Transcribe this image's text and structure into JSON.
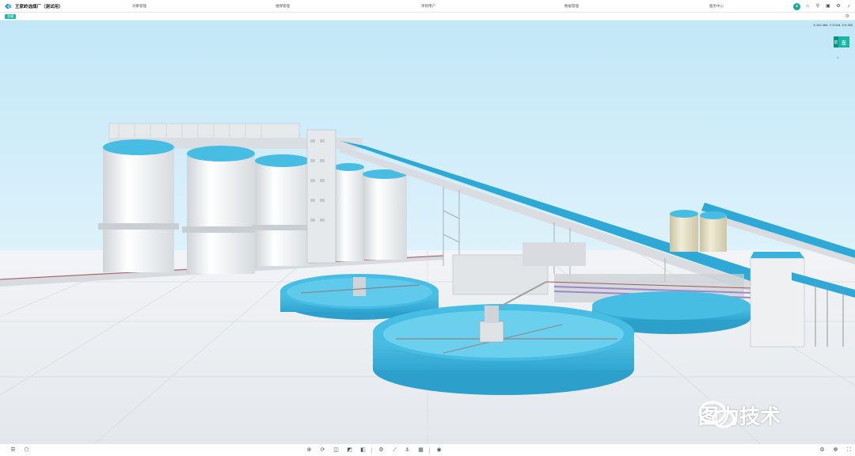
{
  "app": {
    "title": "王家岭选煤厂（测试用）"
  },
  "nav": [
    {
      "label": "对象管理"
    },
    {
      "label": "维保管理"
    },
    {
      "label": "项目用户"
    },
    {
      "label": "数据管理"
    },
    {
      "label": "服务中心"
    }
  ],
  "top_icons": [
    "user-avatar-icon",
    "home-icon",
    "search-icon",
    "layers-icon",
    "gear-icon",
    "bell-icon"
  ],
  "subbar": {
    "tag_label": "主模"
  },
  "viewport": {
    "coords": "X:162.466, Y:3.518, Z:0.350",
    "viewcube": {
      "side_label": "前",
      "front_label": "左"
    }
  },
  "watermark": {
    "text": "图力技术"
  },
  "bottom_tools": [
    "menu-icon",
    "model-tree-icon",
    "home-view-icon",
    "orbit-icon",
    "box-icon",
    "section-icon",
    "cube-view-icon",
    "settings-view-icon",
    "walk-icon",
    "measure-icon",
    "marker-icon",
    "annotate-icon",
    "roam-icon",
    "setting-icon",
    "fullscreen-icon"
  ],
  "colors": {
    "accent": "#16b8a4",
    "tank_blue": "#3bb6de",
    "sky_top": "#c6e9f7",
    "ground": "#eef1f4"
  }
}
